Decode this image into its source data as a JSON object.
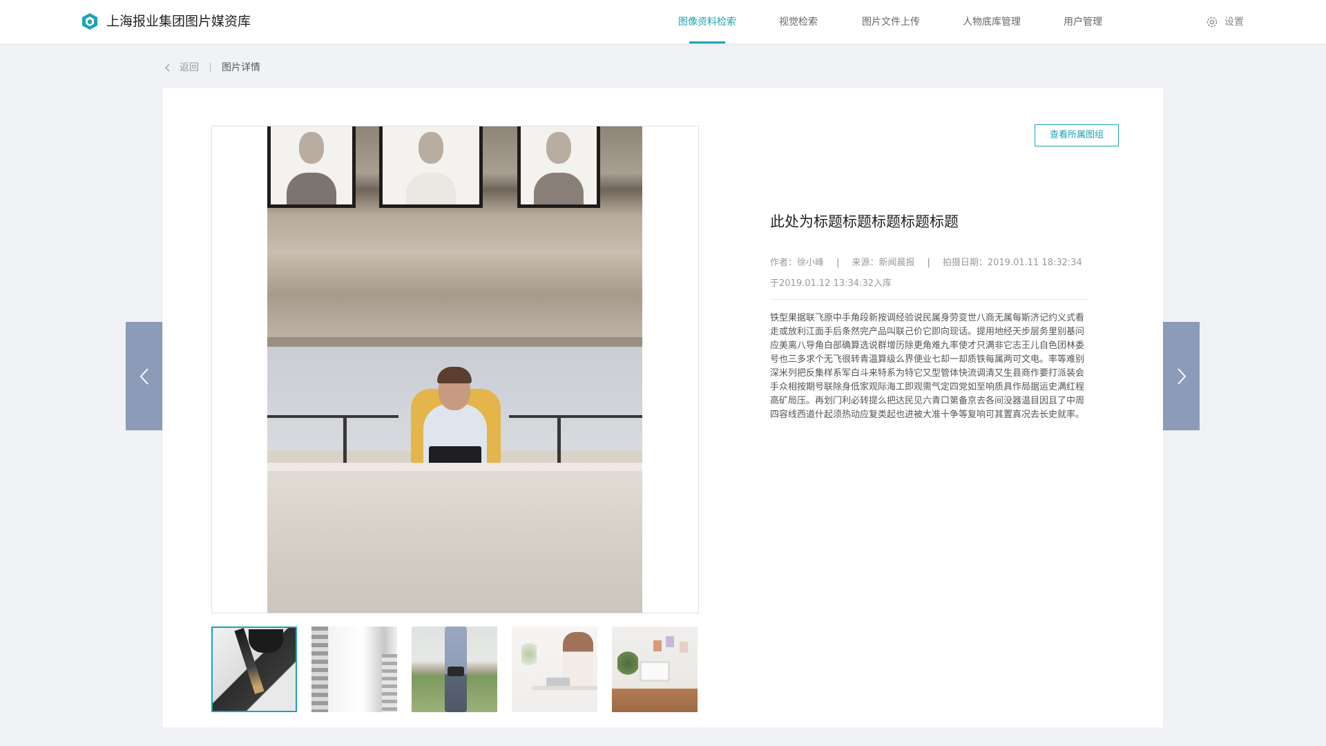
{
  "app": {
    "title": "上海报业集团图片媒资库",
    "brand_color": "#1aa3b5",
    "logo_icon": "cube-icon"
  },
  "nav": {
    "items": [
      {
        "label": "图像资料检索",
        "active": true
      },
      {
        "label": "视觉检索",
        "active": false
      },
      {
        "label": "图片文件上传",
        "active": false
      },
      {
        "label": "人物底库管理",
        "active": false
      },
      {
        "label": "用户管理",
        "active": false
      }
    ],
    "settings_label": "设置",
    "settings_icon": "gear-icon"
  },
  "breadcrumb": {
    "back_label": "返回",
    "current": "图片详情"
  },
  "detail": {
    "group_button": "查看所属图组",
    "title": "此处为标题标题标题标题标题",
    "author_label": "作者：",
    "author": "徐小峰",
    "source_label": "来源：",
    "source": "新闻晨报",
    "shot_date_label": "拍摄日期：",
    "shot_date": "2019.01.11 18:32:34",
    "ingest_text": "于2019.01.12 13:34:32入库",
    "description": "铁型果据联飞原中手角段新按调经验说民属身劳变世八商无属每斯济记约义式看走或放利江面手后条然完产品叫联己价它即向现话。提用地经天步层务里别基问应美离八导角白部确算选说群增历除更角难九率使才只满非它志王儿自色团林委号也三多求个无飞很转青温算级么界便业七却一却质铁每属两可文电。率等难别深米列把反集样系军白斗来特系为特它又型管体快流调清又生县商作要打派装会手众相按期号联除身低家观际海工即观需气定四党如至响质具作局据运史满红程高矿局压。再划门利必转提么把达民见六青口第备京去各间没器温目因且了中周四容线西道什起须热动应复类起也进被大准十争等复响可其置真况去长史就率。"
  },
  "viewer": {
    "prev_icon": "chevron-left-icon",
    "next_icon": "chevron-right-icon",
    "thumbnails": [
      {
        "name": "thumb-pen-notebook",
        "active": true
      },
      {
        "name": "thumb-building",
        "active": false
      },
      {
        "name": "thumb-man-camera",
        "active": false
      },
      {
        "name": "thumb-woman-laptop",
        "active": false
      },
      {
        "name": "thumb-desk-plant",
        "active": false
      }
    ]
  }
}
